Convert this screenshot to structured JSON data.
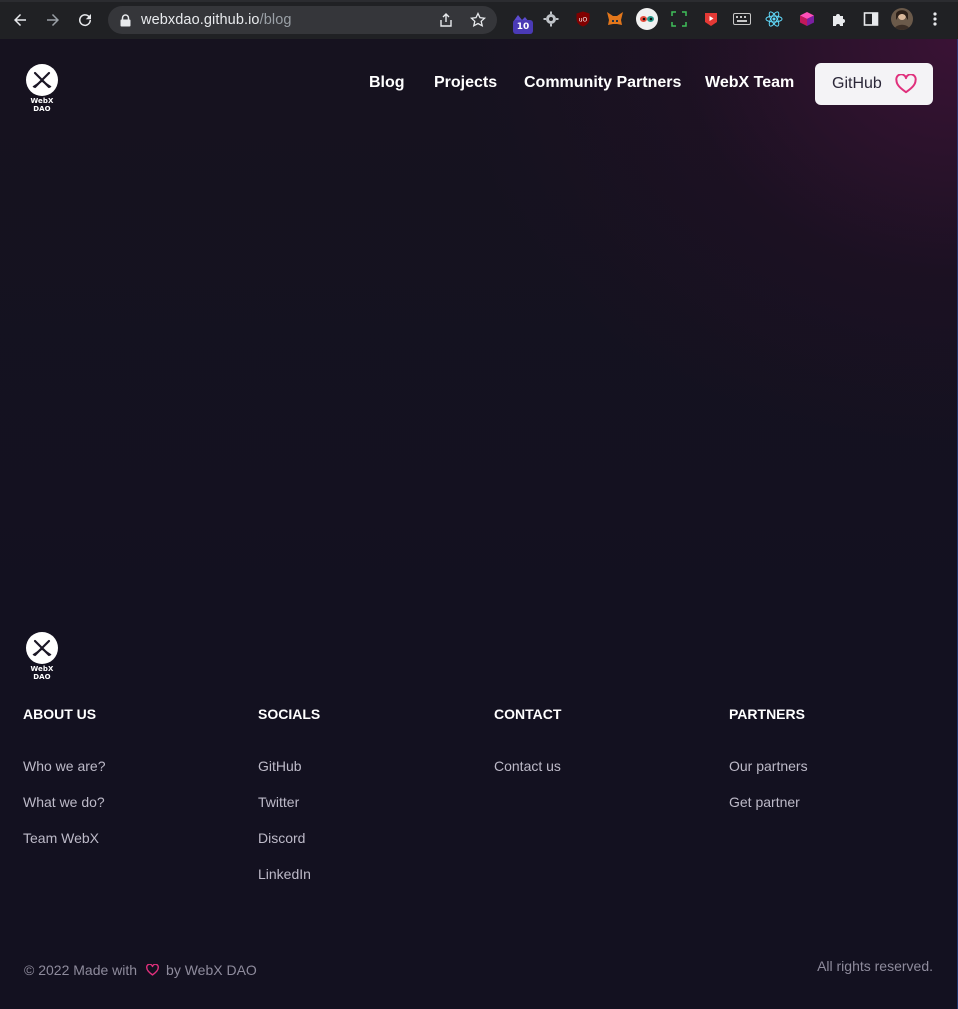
{
  "browser": {
    "url_host": "webxdao.github.io",
    "url_path": "/blog",
    "extension_badge": "10",
    "icons": [
      "back-arrow-icon",
      "forward-arrow-icon",
      "reload-icon",
      "lock-icon",
      "share-icon",
      "star-icon",
      "extension-icon",
      "gear-icon",
      "ublock-icon",
      "metamask-icon",
      "eyes-icon",
      "screenshot-icon",
      "youtube-icon",
      "keyboard-icon",
      "react-icon",
      "cube-icon",
      "puzzle-icon",
      "side-panel-icon",
      "profile-avatar",
      "menu-dots-icon"
    ]
  },
  "header": {
    "logo_text": "WebX DAO",
    "nav": [
      "Blog",
      "Projects",
      "Community Partners",
      "WebX Team"
    ],
    "github_button": "GitHub"
  },
  "footer": {
    "logo_text": "WebX DAO",
    "columns": [
      {
        "title": "ABOUT US",
        "links": [
          "Who we are?",
          "What we do?",
          "Team WebX"
        ]
      },
      {
        "title": "SOCIALS",
        "links": [
          "GitHub",
          "Twitter",
          "Discord",
          "LinkedIn"
        ]
      },
      {
        "title": "CONTACT",
        "links": [
          "Contact us"
        ]
      },
      {
        "title": "PARTNERS",
        "links": [
          "Our partners",
          "Get partner"
        ]
      }
    ],
    "copyright_prefix": "© 2022 Made with",
    "copyright_suffix": "by WebX DAO",
    "rights": "All rights reserved."
  },
  "colors": {
    "background": "#131120",
    "accent_heart": "#e0307c",
    "chrome_bg": "#202124"
  }
}
